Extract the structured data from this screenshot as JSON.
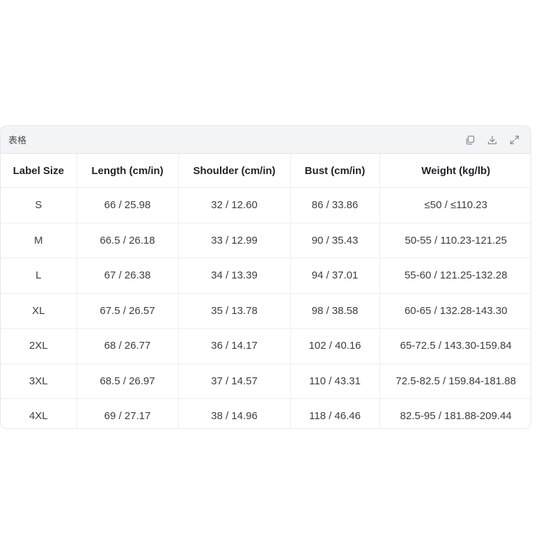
{
  "card": {
    "title": "表格",
    "tools": [
      {
        "icon": "copy-icon"
      },
      {
        "icon": "download-icon"
      },
      {
        "icon": "expand-icon"
      }
    ]
  },
  "table": {
    "headers": [
      "Label Size",
      "Length (cm/in)",
      "Shoulder (cm/in)",
      "Bust (cm/in)",
      "Weight (kg/lb)"
    ],
    "rows": [
      [
        "S",
        "66 / 25.98",
        "32 / 12.60",
        "86 / 33.86",
        "≤50 / ≤110.23"
      ],
      [
        "M",
        "66.5 / 26.18",
        "33 / 12.99",
        "90 / 35.43",
        "50-55 / 110.23-121.25"
      ],
      [
        "L",
        "67 / 26.38",
        "34 / 13.39",
        "94 / 37.01",
        "55-60 / 121.25-132.28"
      ],
      [
        "XL",
        "67.5 / 26.57",
        "35 / 13.78",
        "98 / 38.58",
        "60-65 / 132.28-143.30"
      ],
      [
        "2XL",
        "68 / 26.77",
        "36 / 14.17",
        "102 / 40.16",
        "65-72.5 / 143.30-159.84"
      ],
      [
        "3XL",
        "68.5 / 26.97",
        "37 / 14.57",
        "110 / 43.31",
        "72.5-82.5 / 159.84-181.88"
      ],
      [
        "4XL",
        "69 / 27.17",
        "38 / 14.96",
        "118 / 46.46",
        "82.5-95 / 181.88-209.44"
      ]
    ]
  }
}
